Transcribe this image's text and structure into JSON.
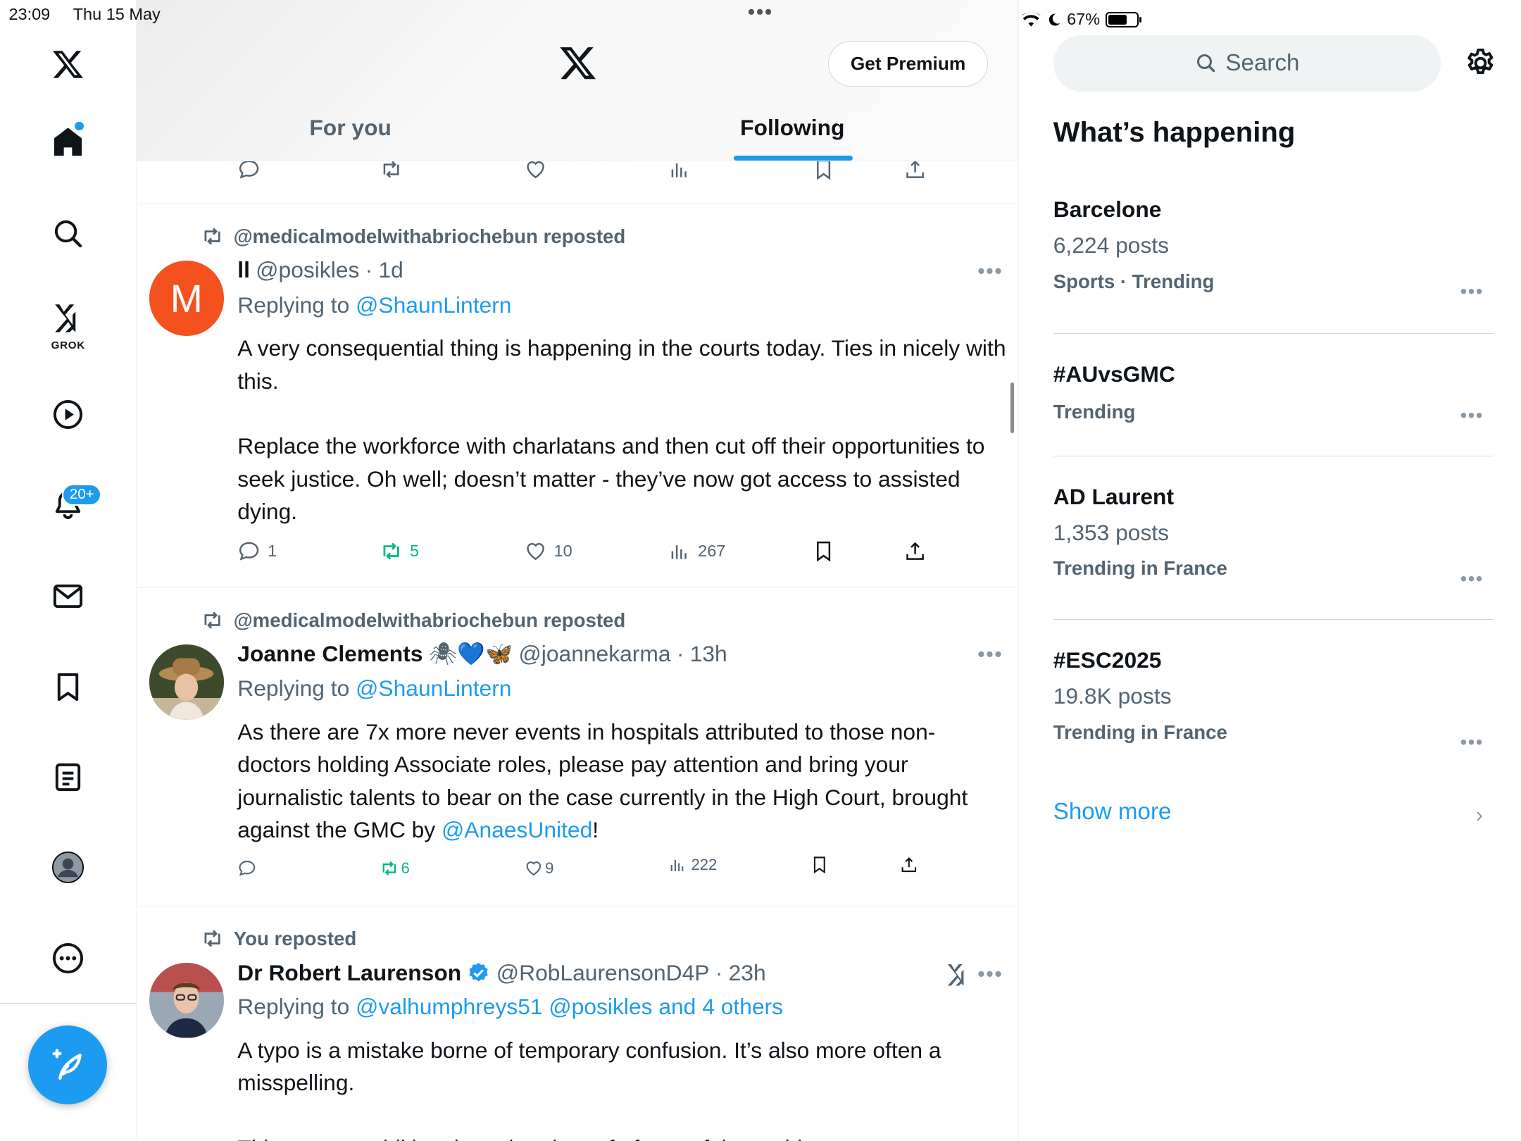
{
  "status_bar": {
    "time": "23:09",
    "date": "Thu 15 May",
    "battery": "67%",
    "battery_level": 0.67
  },
  "sidebar": {
    "items": [
      "home",
      "explore",
      "grok",
      "video",
      "notifications",
      "messages",
      "bookmarks",
      "lists",
      "profile",
      "more"
    ],
    "grok_label": "GROK",
    "notifications_badge": "20+"
  },
  "header": {
    "get_premium": "Get Premium",
    "tabs": [
      {
        "label": "For you",
        "active": false
      },
      {
        "label": "Following",
        "active": true
      }
    ]
  },
  "feed": [
    {
      "reposted_by": "@medicalmodelwithabriochebun reposted",
      "avatar_letter": "M",
      "avatar_color": "#f4511e",
      "name": "ll",
      "handle": "@posikles",
      "time": "1d",
      "replying_label": "Replying to",
      "replying_to": "@ShaunLintern",
      "text_p1": "A very consequential thing is happening in the courts today. Ties in nicely with this.",
      "text_p2": "Replace the workforce with charlatans and then cut off their opportunities to seek justice. Oh well; doesn’t matter - they’ve now got access to assisted dying.",
      "replies": "1",
      "reposts": "5",
      "likes": "10",
      "views": "267"
    },
    {
      "reposted_by": "@medicalmodelwithabriochebun reposted",
      "name": "Joanne Clements",
      "name_emoji": "🕷💙🦋",
      "handle": "@joannekarma",
      "time": "13h",
      "replying_label": "Replying to",
      "replying_to": "@ShaunLintern",
      "text": "As there are 7x more never events in hospitals attributed to those non-doctors holding Associate roles, please pay attention and bring your journalistic talents to bear on the case currently in the High Court, brought against the GMC by",
      "text_mention": "@AnaesUnited",
      "text_end": "!",
      "replies": "",
      "reposts": "6",
      "likes": "9",
      "views": "222"
    },
    {
      "reposted_by": "You reposted",
      "name": "Dr Robert Laurenson",
      "verified": true,
      "handle": "@RobLaurensonD4P",
      "time": "23h",
      "replying_label": "Replying to",
      "replying_to": "@valhumphreys51 @posikles and 4 others",
      "text": "A typo is a mistake borne of temporary confusion. It’s also more often a misspelling.",
      "text_cut": "This was an additional word and proof of part of the problem."
    }
  ],
  "right": {
    "search_placeholder": "Search",
    "heading": "What’s happening",
    "trends": [
      {
        "title": "Barcelone",
        "posts": "6,224 posts",
        "context": "Sports · Trending"
      },
      {
        "title": "#AUvsGMC",
        "posts": "",
        "context": "Trending"
      },
      {
        "title": "AD Laurent",
        "posts": "1,353 posts",
        "context": "Trending in France"
      },
      {
        "title": "#ESC2025",
        "posts": "19.8K posts",
        "context": "Trending in France"
      }
    ],
    "show_more": "Show more"
  },
  "colors": {
    "accent": "#1d9bf0",
    "repost_green": "#00ba7c",
    "muted": "#536471"
  }
}
